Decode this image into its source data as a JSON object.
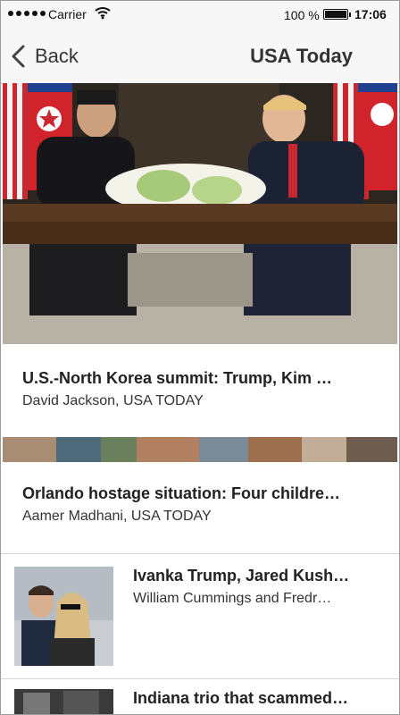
{
  "status_bar": {
    "carrier": "Carrier",
    "battery_percent": "100 %",
    "time": "17:06"
  },
  "nav": {
    "back_label": "Back",
    "title": "USA Today"
  },
  "articles": [
    {
      "headline": "U.S.-North Korea summit: Trump, Kim …",
      "byline": "David Jackson, USA TODAY"
    },
    {
      "headline": "Orlando hostage situation: Four childre…",
      "byline": "Aamer Madhani, USA TODAY"
    },
    {
      "headline": "Ivanka Trump, Jared Kush…",
      "byline": "William Cummings and Fredr…"
    },
    {
      "headline": "Indiana trio that scammed…",
      "byline": ""
    }
  ],
  "icons": {
    "back": "chevron-left-icon",
    "wifi": "wifi-icon",
    "battery": "battery-icon"
  }
}
